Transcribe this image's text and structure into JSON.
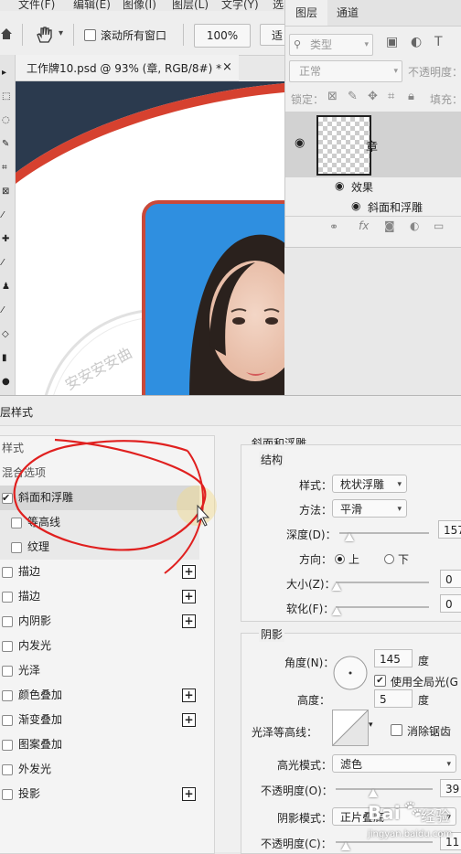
{
  "menu": {
    "items": [
      "文件(F)",
      "编辑(E)",
      "图像(I)",
      "图层(L)",
      "文字(Y)",
      "选"
    ]
  },
  "options": {
    "scroll_all_windows": "滚动所有窗口",
    "zoom": "100%",
    "fit": "适"
  },
  "document": {
    "tab_title": "工作牌10.psd @ 93% (章, RGB/8#) *",
    "close": "×",
    "stamp_text": "安安安安曲"
  },
  "layers_panel": {
    "tabs": [
      "图层",
      "通道"
    ],
    "filter_kind": "类型",
    "blend_mode": "正常",
    "opacity_label": "不透明度：",
    "lock_label": "锁定：",
    "fill_label": "填充：",
    "layer_name": "章",
    "effects_label": "效果",
    "effect_item": "斜面和浮雕"
  },
  "dialog": {
    "title": "层样式",
    "styles": [
      {
        "label": "样式",
        "type": "header"
      },
      {
        "label": "混合选项",
        "type": "header"
      },
      {
        "label": "斜面和浮雕",
        "type": "item",
        "checked": true,
        "selected": true,
        "indent": false,
        "plus": false
      },
      {
        "label": "等高线",
        "type": "item",
        "checked": false,
        "indent": true,
        "plus": false
      },
      {
        "label": "纹理",
        "type": "item",
        "checked": false,
        "indent": true,
        "plus": false
      },
      {
        "label": "描边",
        "type": "item",
        "checked": false,
        "indent": false,
        "plus": true
      },
      {
        "label": "描边",
        "type": "item",
        "checked": false,
        "indent": false,
        "plus": true
      },
      {
        "label": "内阴影",
        "type": "item",
        "checked": false,
        "indent": false,
        "plus": true
      },
      {
        "label": "内发光",
        "type": "item",
        "checked": false,
        "indent": false,
        "plus": false
      },
      {
        "label": "光泽",
        "type": "item",
        "checked": false,
        "indent": false,
        "plus": false
      },
      {
        "label": "颜色叠加",
        "type": "item",
        "checked": false,
        "indent": false,
        "plus": true
      },
      {
        "label": "渐变叠加",
        "type": "item",
        "checked": false,
        "indent": false,
        "plus": true
      },
      {
        "label": "图案叠加",
        "type": "item",
        "checked": false,
        "indent": false,
        "plus": false
      },
      {
        "label": "外发光",
        "type": "item",
        "checked": false,
        "indent": false,
        "plus": false
      },
      {
        "label": "投影",
        "type": "item",
        "checked": false,
        "indent": false,
        "plus": true
      }
    ],
    "bevel": {
      "section_title": "斜面和浮雕",
      "structure_title": "结构",
      "style_label": "样式：",
      "style_value": "枕状浮雕",
      "technique_label": "方法：",
      "technique_value": "平滑",
      "depth_label": "深度(D)：",
      "depth_value": "157",
      "direction_label": "方向：",
      "dir_up": "上",
      "dir_down": "下",
      "size_label": "大小(Z)：",
      "size_value": "0",
      "soften_label": "软化(F)：",
      "soften_value": "0"
    },
    "shading": {
      "title": "阴影",
      "angle_label": "角度(N)：",
      "angle_value": "145",
      "deg": "度",
      "global_light": "使用全局光(G",
      "altitude_label": "高度：",
      "altitude_value": "5",
      "deg2": "度",
      "gloss_label": "光泽等高线：",
      "anti_alias": "消除锯齿",
      "highlight_mode_label": "高光模式：",
      "highlight_mode_value": "滤色",
      "highlight_opacity_label": "不透明度(O)：",
      "highlight_opacity_value": "39",
      "shadow_mode_label": "阴影模式：",
      "shadow_mode_value": "正片叠底",
      "shadow_opacity_label": "不透明度(C)：",
      "shadow_opacity_value": "11"
    }
  },
  "watermark": {
    "brand": "Bai",
    "suffix": "经验",
    "url": "jingyan.baidu.com"
  },
  "colors": {
    "annotation": "#e0201f",
    "photo_blue": "#2f8fe0",
    "navy": "#2b3a4e"
  }
}
